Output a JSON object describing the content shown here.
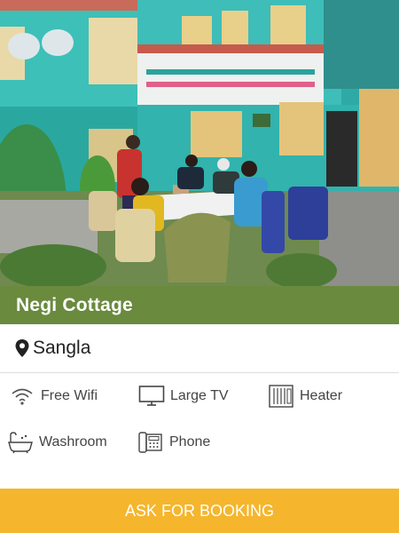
{
  "card": {
    "title": "Negi Cottage",
    "location": "Sangla",
    "amenities": [
      {
        "icon": "wifi-icon",
        "label": "Free Wifi"
      },
      {
        "icon": "tv-icon",
        "label": "Large TV"
      },
      {
        "icon": "heater-icon",
        "label": "Heater"
      },
      {
        "icon": "washroom-icon",
        "label": "Washroom"
      },
      {
        "icon": "phone-icon",
        "label": "Phone"
      }
    ],
    "booking_label": "ASK FOR BOOKING"
  },
  "colors": {
    "brand": "#6a8a3e",
    "accent": "#f5b62d",
    "text": "#222222"
  }
}
